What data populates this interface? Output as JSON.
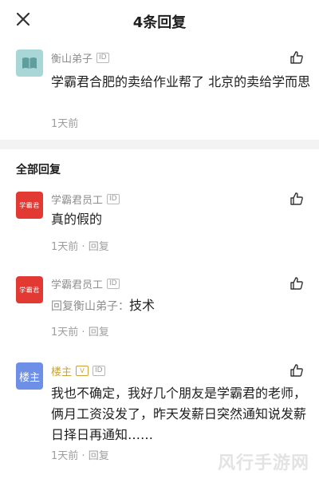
{
  "header": {
    "title": "4条回复",
    "close_icon": "close-icon"
  },
  "top_comment": {
    "user": "衡山弟子",
    "badge": "ID",
    "text": "学霸君合肥的卖给作业帮了 北京的卖给学而思",
    "time": "1天前"
  },
  "section_title": "全部回复",
  "replies": [
    {
      "user": "学霸君员工",
      "badge": "ID",
      "avatar_text": "学霸君",
      "text": "真的假的",
      "time": "1天前",
      "reply_label": "回复"
    },
    {
      "user": "学霸君员工",
      "badge": "ID",
      "avatar_text": "学霸君",
      "reply_prefix": "回复衡山弟子：",
      "text": "技术",
      "time": "1天前",
      "reply_label": "回复"
    },
    {
      "user": "楼主",
      "badge_v": "V",
      "badge": "ID",
      "avatar_text": "楼主",
      "text": "我也不确定，我好几个朋友是学霸君的老师，俩月工资没发了，昨天发薪日突然通知说发薪日择日再通知……",
      "time": "1天前",
      "reply_label": "回复"
    }
  ],
  "watermark": "风行手游网",
  "colors": {
    "brand_red": "#e23a32",
    "host_blue": "#6d8fe8",
    "host_gold": "#c9a43a",
    "book_teal": "#a9d6d6"
  }
}
